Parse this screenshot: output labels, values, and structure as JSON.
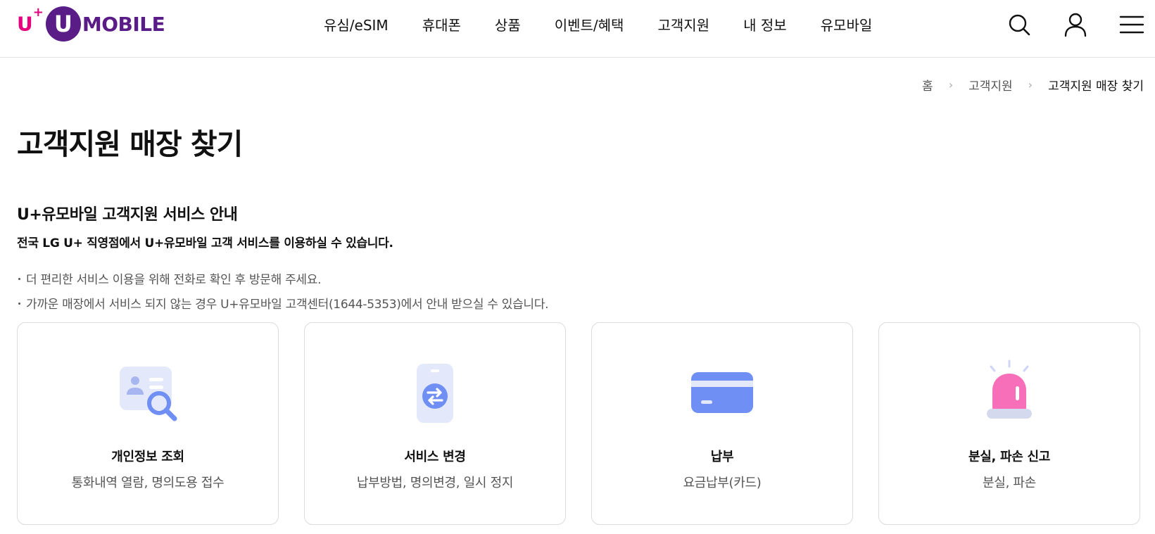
{
  "header": {
    "logo": {
      "u": "U",
      "plus": "+",
      "circle_letter": "U",
      "mobile": "MOBILE"
    },
    "nav": [
      "유심/eSIM",
      "휴대폰",
      "상품",
      "이벤트/혜택",
      "고객지원",
      "내 정보",
      "유모바일"
    ],
    "icons": [
      "search-icon",
      "user-icon",
      "menu-icon"
    ]
  },
  "breadcrumb": [
    "홈",
    "고객지원",
    "고객지원 매장 찾기"
  ],
  "page_title": "고객지원 매장 찾기",
  "section": {
    "title": "U+유모바일 고객지원 서비스 안내",
    "subtitle": "전국 LG U+ 직영점에서 U+유모바일 고객 서비스를 이용하실 수 있습니다.",
    "notes": [
      "더 편리한 서비스 이용을 위해 전화로 확인 후 방문해 주세요.",
      "가까운 매장에서 서비스 되지 않는 경우 U+유모바일 고객센터(1644-5353)에서 안내 받으실 수 있습니다."
    ]
  },
  "cards": [
    {
      "title": "개인정보 조회",
      "desc": "통화내역 열람, 명의도용 접수",
      "icon": "id-card-search-icon"
    },
    {
      "title": "서비스 변경",
      "desc": "납부방법, 명의변경, 일시 정지",
      "icon": "phone-exchange-icon"
    },
    {
      "title": "납부",
      "desc": "요금납부(카드)",
      "icon": "credit-card-icon"
    },
    {
      "title": "분실, 파손 신고",
      "desc": "분실, 파손",
      "icon": "siren-icon"
    }
  ],
  "colors": {
    "brand_pink": "#e6007e",
    "brand_purple": "#5a1d87",
    "icon_blue": "#6f8ff4",
    "icon_light": "#e4e8fb",
    "siren_pink": "#f86fb9"
  }
}
